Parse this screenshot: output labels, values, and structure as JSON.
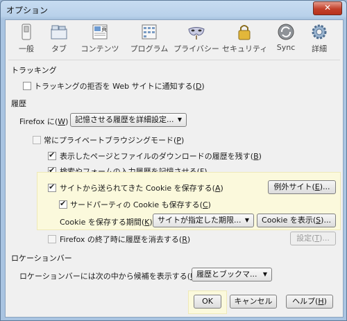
{
  "window": {
    "title": "オプション",
    "close_label": "✕"
  },
  "toolbar": {
    "panes": [
      {
        "label": "一般",
        "icon": "general-switch-icon"
      },
      {
        "label": "タブ",
        "icon": "tabs-icon"
      },
      {
        "label": "コンテンツ",
        "icon": "content-icon"
      },
      {
        "label": "プログラム",
        "icon": "applications-icon"
      },
      {
        "label": "プライバシー",
        "icon": "privacy-mask-icon"
      },
      {
        "label": "セキュリティ",
        "icon": "security-lock-icon"
      },
      {
        "label": "Sync",
        "icon": "sync-icon"
      },
      {
        "label": "詳細",
        "icon": "advanced-gear-icon"
      }
    ],
    "selected": "プライバシー"
  },
  "tracking": {
    "heading": "トラッキング",
    "dnt_label": "トラッキングの拒否を Web サイトに通知する(",
    "dnt_key": "D",
    "dnt_checked": false
  },
  "history": {
    "heading": "履歴",
    "firefox_will_label": "Firefox に(",
    "firefox_will_key": "W",
    "mode_value": "記憶させる履歴を詳細設定...",
    "private_label": "常にプライベートブラウジングモード(",
    "private_key": "P",
    "private_checked": false,
    "remember_browsing_label": "表示したページとファイルのダウンロードの履歴を残す(",
    "remember_browsing_key": "B",
    "remember_browsing_checked": true,
    "remember_search_label": "検索やフォームの入力履歴を記憶させる(",
    "remember_search_key": "F",
    "remember_search_checked": true,
    "accept_cookies_label": "サイトから送られてきた Cookie を保存する(",
    "accept_cookies_key": "A",
    "accept_cookies_checked": true,
    "exceptions_label": "例外サイト(",
    "exceptions_key": "E",
    "third_party_label": "サードパーティの Cookie も保存する(",
    "third_party_key": "C",
    "third_party_checked": true,
    "keep_until_label": "Cookie を保存する期間(",
    "keep_until_key": "K",
    "keep_until_value": "サイトが指定した期限...",
    "show_cookies_label": "Cookie を表示(",
    "show_cookies_key": "S",
    "clear_on_close_label": "Firefox の終了時に履歴を消去する(",
    "clear_on_close_key": "R",
    "clear_on_close_checked": false,
    "settings_label": "設定(",
    "settings_key": "T"
  },
  "location_bar": {
    "heading": "ロケーションバー",
    "suggest_label": "ロケーションバーには次の中から候補を表示する(",
    "suggest_key": "U",
    "suggest_value": "履歴とブックマ..."
  },
  "footer": {
    "ok_label": "OK",
    "cancel_label": "キャンセル",
    "help_label": "ヘルプ(",
    "help_key": "H"
  }
}
